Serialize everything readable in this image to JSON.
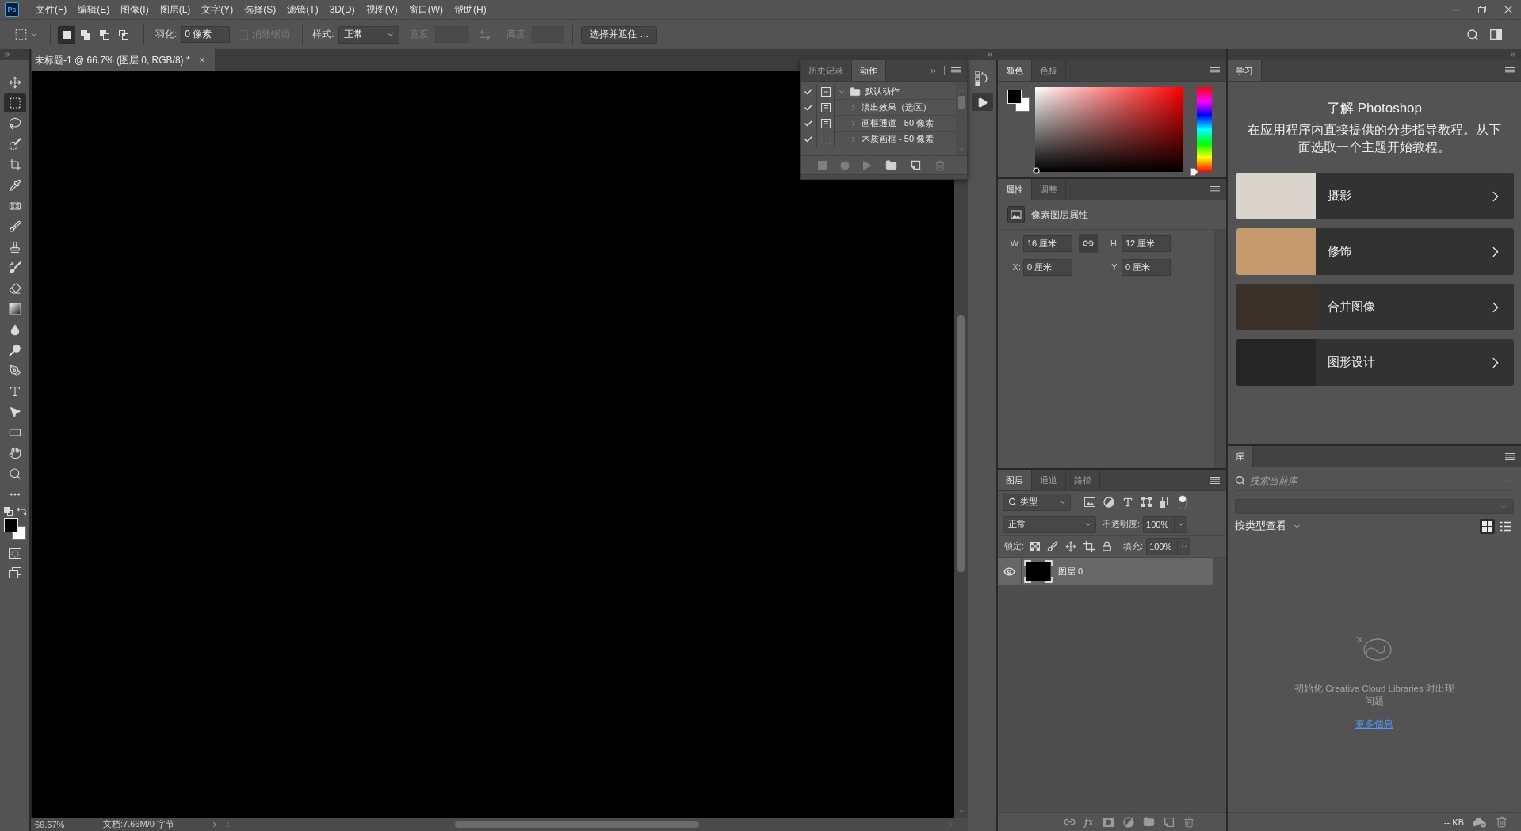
{
  "menu_bar": {
    "logo": "Ps",
    "items": [
      "文件(F)",
      "编辑(E)",
      "图像(I)",
      "图层(L)",
      "文字(Y)",
      "选择(S)",
      "滤镜(T)",
      "3D(D)",
      "视图(V)",
      "窗口(W)",
      "帮助(H)"
    ]
  },
  "options_bar": {
    "selection_modes": [
      {
        "kind": "new",
        "selected": true
      },
      {
        "kind": "add",
        "selected": false
      },
      {
        "kind": "subtract",
        "selected": false
      },
      {
        "kind": "intersect",
        "selected": false
      }
    ],
    "feather": {
      "label": "羽化:",
      "value": "0 像素"
    },
    "anti_alias": {
      "label": "消除锯齿",
      "checked": false,
      "disabled": true
    },
    "style": {
      "label": "样式:",
      "value": "正常"
    },
    "width": {
      "label": "宽度:",
      "disabled": true
    },
    "height": {
      "label": "高度:",
      "disabled": true
    },
    "refine_button": "选择并遮住 ..."
  },
  "tools": [
    {
      "kind": "move",
      "selected": false
    },
    {
      "kind": "marquee",
      "selected": true
    },
    {
      "kind": "lasso",
      "selected": false
    },
    {
      "kind": "quick_select",
      "selected": false
    },
    {
      "kind": "crop",
      "selected": false
    },
    {
      "kind": "eyedropper",
      "selected": false
    },
    {
      "kind": "healing",
      "selected": false
    },
    {
      "kind": "brush",
      "selected": false
    },
    {
      "kind": "stamp",
      "selected": false
    },
    {
      "kind": "history_brush",
      "selected": false
    },
    {
      "kind": "eraser",
      "selected": false
    },
    {
      "kind": "gradient",
      "selected": false
    },
    {
      "kind": "blur",
      "selected": false
    },
    {
      "kind": "dodge",
      "selected": false
    },
    {
      "kind": "pen",
      "selected": false
    },
    {
      "kind": "type",
      "selected": false
    },
    {
      "kind": "path_select",
      "selected": false
    },
    {
      "kind": "rectangle",
      "selected": false
    },
    {
      "kind": "hand",
      "selected": false
    },
    {
      "kind": "zoom",
      "selected": false
    },
    {
      "kind": "more",
      "selected": false
    }
  ],
  "document": {
    "tab": {
      "title": "未标题-1 @ 66.7% (图层 0, RGB/8) *",
      "close": "×",
      "selected": true
    },
    "status": {
      "zoom": "66.67%",
      "info": "文档:7.66M/0 字节"
    }
  },
  "actions_panel": {
    "tabs": [
      {
        "label": "历史记录",
        "selected": false
      },
      {
        "label": "动作",
        "selected": true
      }
    ],
    "actions": [
      {
        "name": "默认动作",
        "checked": true,
        "dialog": true,
        "expanded": true,
        "children": [
          {
            "name": "淡出效果（选区）",
            "checked": true,
            "dialog": true,
            "expanded": false
          },
          {
            "name": "画框通道 - 50 像素",
            "checked": true,
            "dialog": true,
            "expanded": false
          },
          {
            "name": "木质画框 - 50 像素",
            "checked": true,
            "dialog": false,
            "expanded": false
          }
        ]
      }
    ]
  },
  "color_panel": {
    "tabs": [
      {
        "label": "颜色",
        "selected": true
      },
      {
        "label": "色板",
        "selected": false
      }
    ],
    "hue_slider": {
      "level": 0
    }
  },
  "properties_panel": {
    "tabs": [
      {
        "label": "属性",
        "selected": true
      },
      {
        "label": "调整",
        "selected": false
      }
    ],
    "title": "像素图层属性",
    "fields": [
      {
        "label": "W:",
        "value": "16 厘米"
      },
      {
        "label": "H:",
        "value": "12 厘米"
      },
      {
        "label": "X:",
        "value": "0 厘米"
      },
      {
        "label": "Y:",
        "value": "0 厘米"
      }
    ]
  },
  "layers_panel": {
    "tabs": [
      {
        "label": "图层",
        "selected": true
      },
      {
        "label": "通道",
        "selected": false
      },
      {
        "label": "路径",
        "selected": false
      }
    ],
    "filter": {
      "value": "类型",
      "on": true
    },
    "blend_mode": "正常",
    "opacity": {
      "label": "不透明度:",
      "value": "100%"
    },
    "lock": {
      "label": "锁定:"
    },
    "fill": {
      "label": "填充:",
      "value": "100%"
    },
    "layers": [
      {
        "name": "图层 0",
        "visible": true,
        "selected": true
      }
    ],
    "effects_button": "fx"
  },
  "learn_panel": {
    "tabs": [
      {
        "label": "学习",
        "selected": true
      }
    ],
    "title": "了解 Photoshop",
    "description": "在应用程序内直接提供的分步指导教程。从下面选取一个主题开始教程。",
    "topics": [
      "摄影",
      "修饰",
      "合并图像",
      "图形设计"
    ]
  },
  "library_panel": {
    "tabs": [
      {
        "label": "库",
        "selected": true
      }
    ],
    "search": {
      "placeholder": "搜索当前库"
    },
    "view_by": "按类型查看",
    "view_modes": [
      {
        "kind": "grid",
        "selected": true
      },
      {
        "kind": "list",
        "selected": false
      }
    ],
    "message": "初始化 Creative Cloud Libraries 时出现问题",
    "link": "更多信息",
    "storage": "-- KB"
  }
}
